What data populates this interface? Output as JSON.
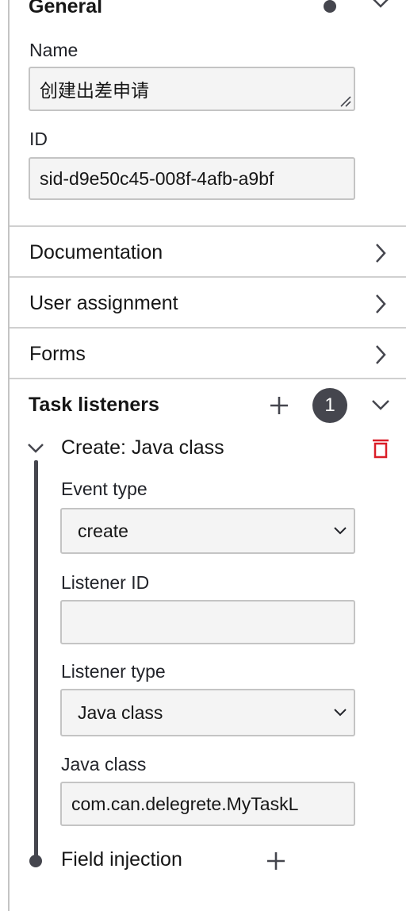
{
  "general": {
    "title": "General",
    "name_label": "Name",
    "name_value": "创建出差申请",
    "id_label": "ID",
    "id_value": "sid-d9e50c45-008f-4afb-a9bf"
  },
  "sections": [
    {
      "label": "Documentation"
    },
    {
      "label": "User assignment"
    },
    {
      "label": "Forms"
    }
  ],
  "task_listeners": {
    "title": "Task listeners",
    "count": "1",
    "listener": {
      "title": "Create: Java class",
      "event_type_label": "Event type",
      "event_type_value": "create",
      "listener_id_label": "Listener ID",
      "listener_id_value": "",
      "listener_type_label": "Listener type",
      "listener_type_value": "Java class",
      "java_class_label": "Java class",
      "java_class_value": "com.can.delegrete.MyTaskL",
      "field_injection_label": "Field injection"
    }
  },
  "icons": {
    "chevron_down": "chevron-down-icon",
    "chevron_right": "chevron-right-icon",
    "add": "plus-icon",
    "delete": "trash-icon"
  },
  "colors": {
    "delete_red": "#da1e28",
    "badge_bg": "#45464e",
    "field_bg": "#f4f4f4"
  }
}
